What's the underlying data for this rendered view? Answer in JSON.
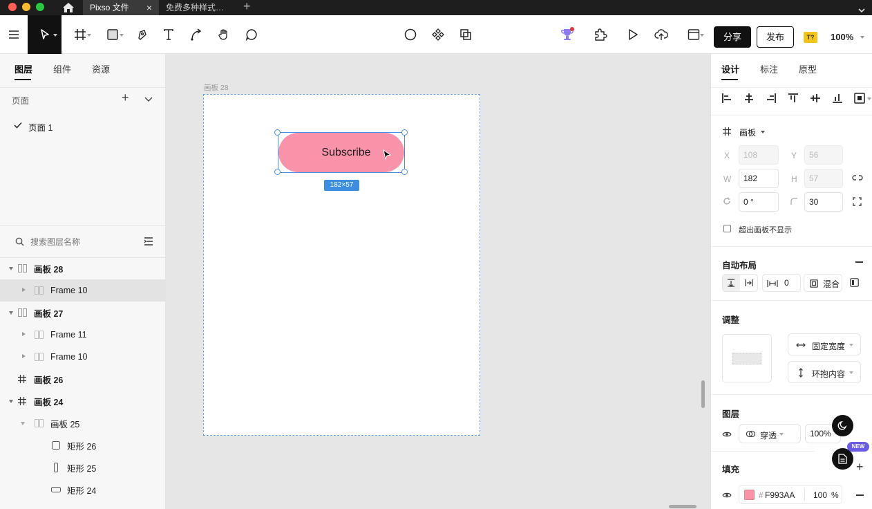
{
  "titlebar": {
    "tabs": [
      {
        "label": "Pixso 文件",
        "active": true
      },
      {
        "label": "免费多种样式…",
        "active": false
      }
    ]
  },
  "toolbar": {
    "share_label": "分享",
    "publish_label": "发布",
    "badge_label": "T?",
    "zoom": "100%"
  },
  "left_panel": {
    "tabs": [
      "图层",
      "组件",
      "资源"
    ],
    "pages_title": "页面",
    "pages": [
      "页面 1"
    ],
    "search_placeholder": "搜索图层名称",
    "layers": [
      {
        "name": "画板 28"
      },
      {
        "name": "Frame 10"
      },
      {
        "name": "画板 27"
      },
      {
        "name": "Frame 11"
      },
      {
        "name": "Frame 10"
      },
      {
        "name": "画板 26"
      },
      {
        "name": "画板 24"
      },
      {
        "name": "画板 25"
      },
      {
        "name": "矩形 26"
      },
      {
        "name": "矩形 25"
      },
      {
        "name": "矩形 24"
      }
    ]
  },
  "canvas": {
    "frame_label": "画板 28",
    "button_text": "Subscribe",
    "size_badge": "182×57",
    "colors": {
      "button_fill": "#F993AA",
      "selection": "#4a90e2"
    }
  },
  "right_panel": {
    "tabs": [
      "设计",
      "标注",
      "原型"
    ],
    "frame_type": "画板",
    "x_label": "X",
    "x_value": "108",
    "y_label": "Y",
    "y_value": "56",
    "w_label": "W",
    "w_value": "182",
    "h_label": "H",
    "h_value": "57",
    "rotation": "0 °",
    "radius": "30",
    "clip_label": "超出画板不显示",
    "auto_layout_title": "自动布局",
    "spacing": "0",
    "mix_label": "混合",
    "adjust_title": "调整",
    "fixed_width": "固定宽度",
    "hug_content": "环抱内容",
    "layer_title": "图层",
    "blend_mode": "穿透",
    "layer_opacity": "100%",
    "fill_title": "填充",
    "fill_hash": "#",
    "fill_hex": "F993AA",
    "fill_opacity": "100",
    "fill_percent": "%",
    "new_badge": "NEW"
  }
}
